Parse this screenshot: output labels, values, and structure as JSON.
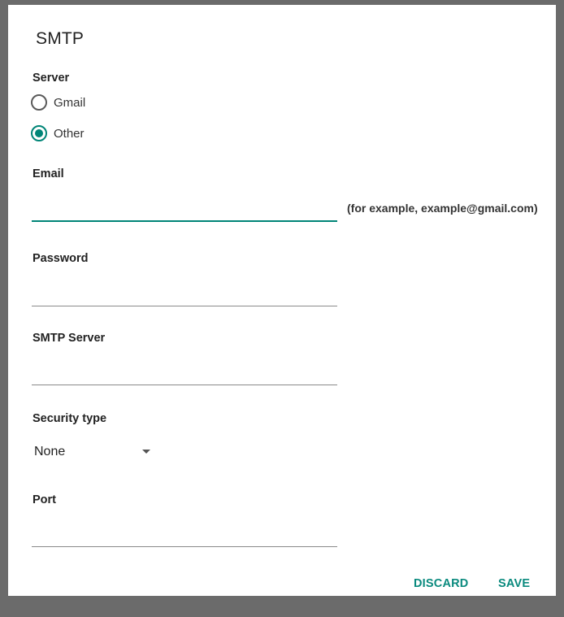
{
  "dialog": {
    "title": "SMTP"
  },
  "server": {
    "label": "Server",
    "options": [
      {
        "label": "Gmail",
        "checked": false
      },
      {
        "label": "Other",
        "checked": true
      }
    ]
  },
  "email": {
    "label": "Email",
    "value": "",
    "hint": "(for example, example@gmail.com)"
  },
  "password": {
    "label": "Password",
    "value": ""
  },
  "smtp_server": {
    "label": "SMTP Server",
    "value": ""
  },
  "security_type": {
    "label": "Security type",
    "selected": "None"
  },
  "port": {
    "label": "Port",
    "value": ""
  },
  "actions": {
    "discard": "DISCARD",
    "save": "SAVE"
  },
  "colors": {
    "accent": "#008577",
    "text": "#222222",
    "underline": "#8a8a8a"
  }
}
